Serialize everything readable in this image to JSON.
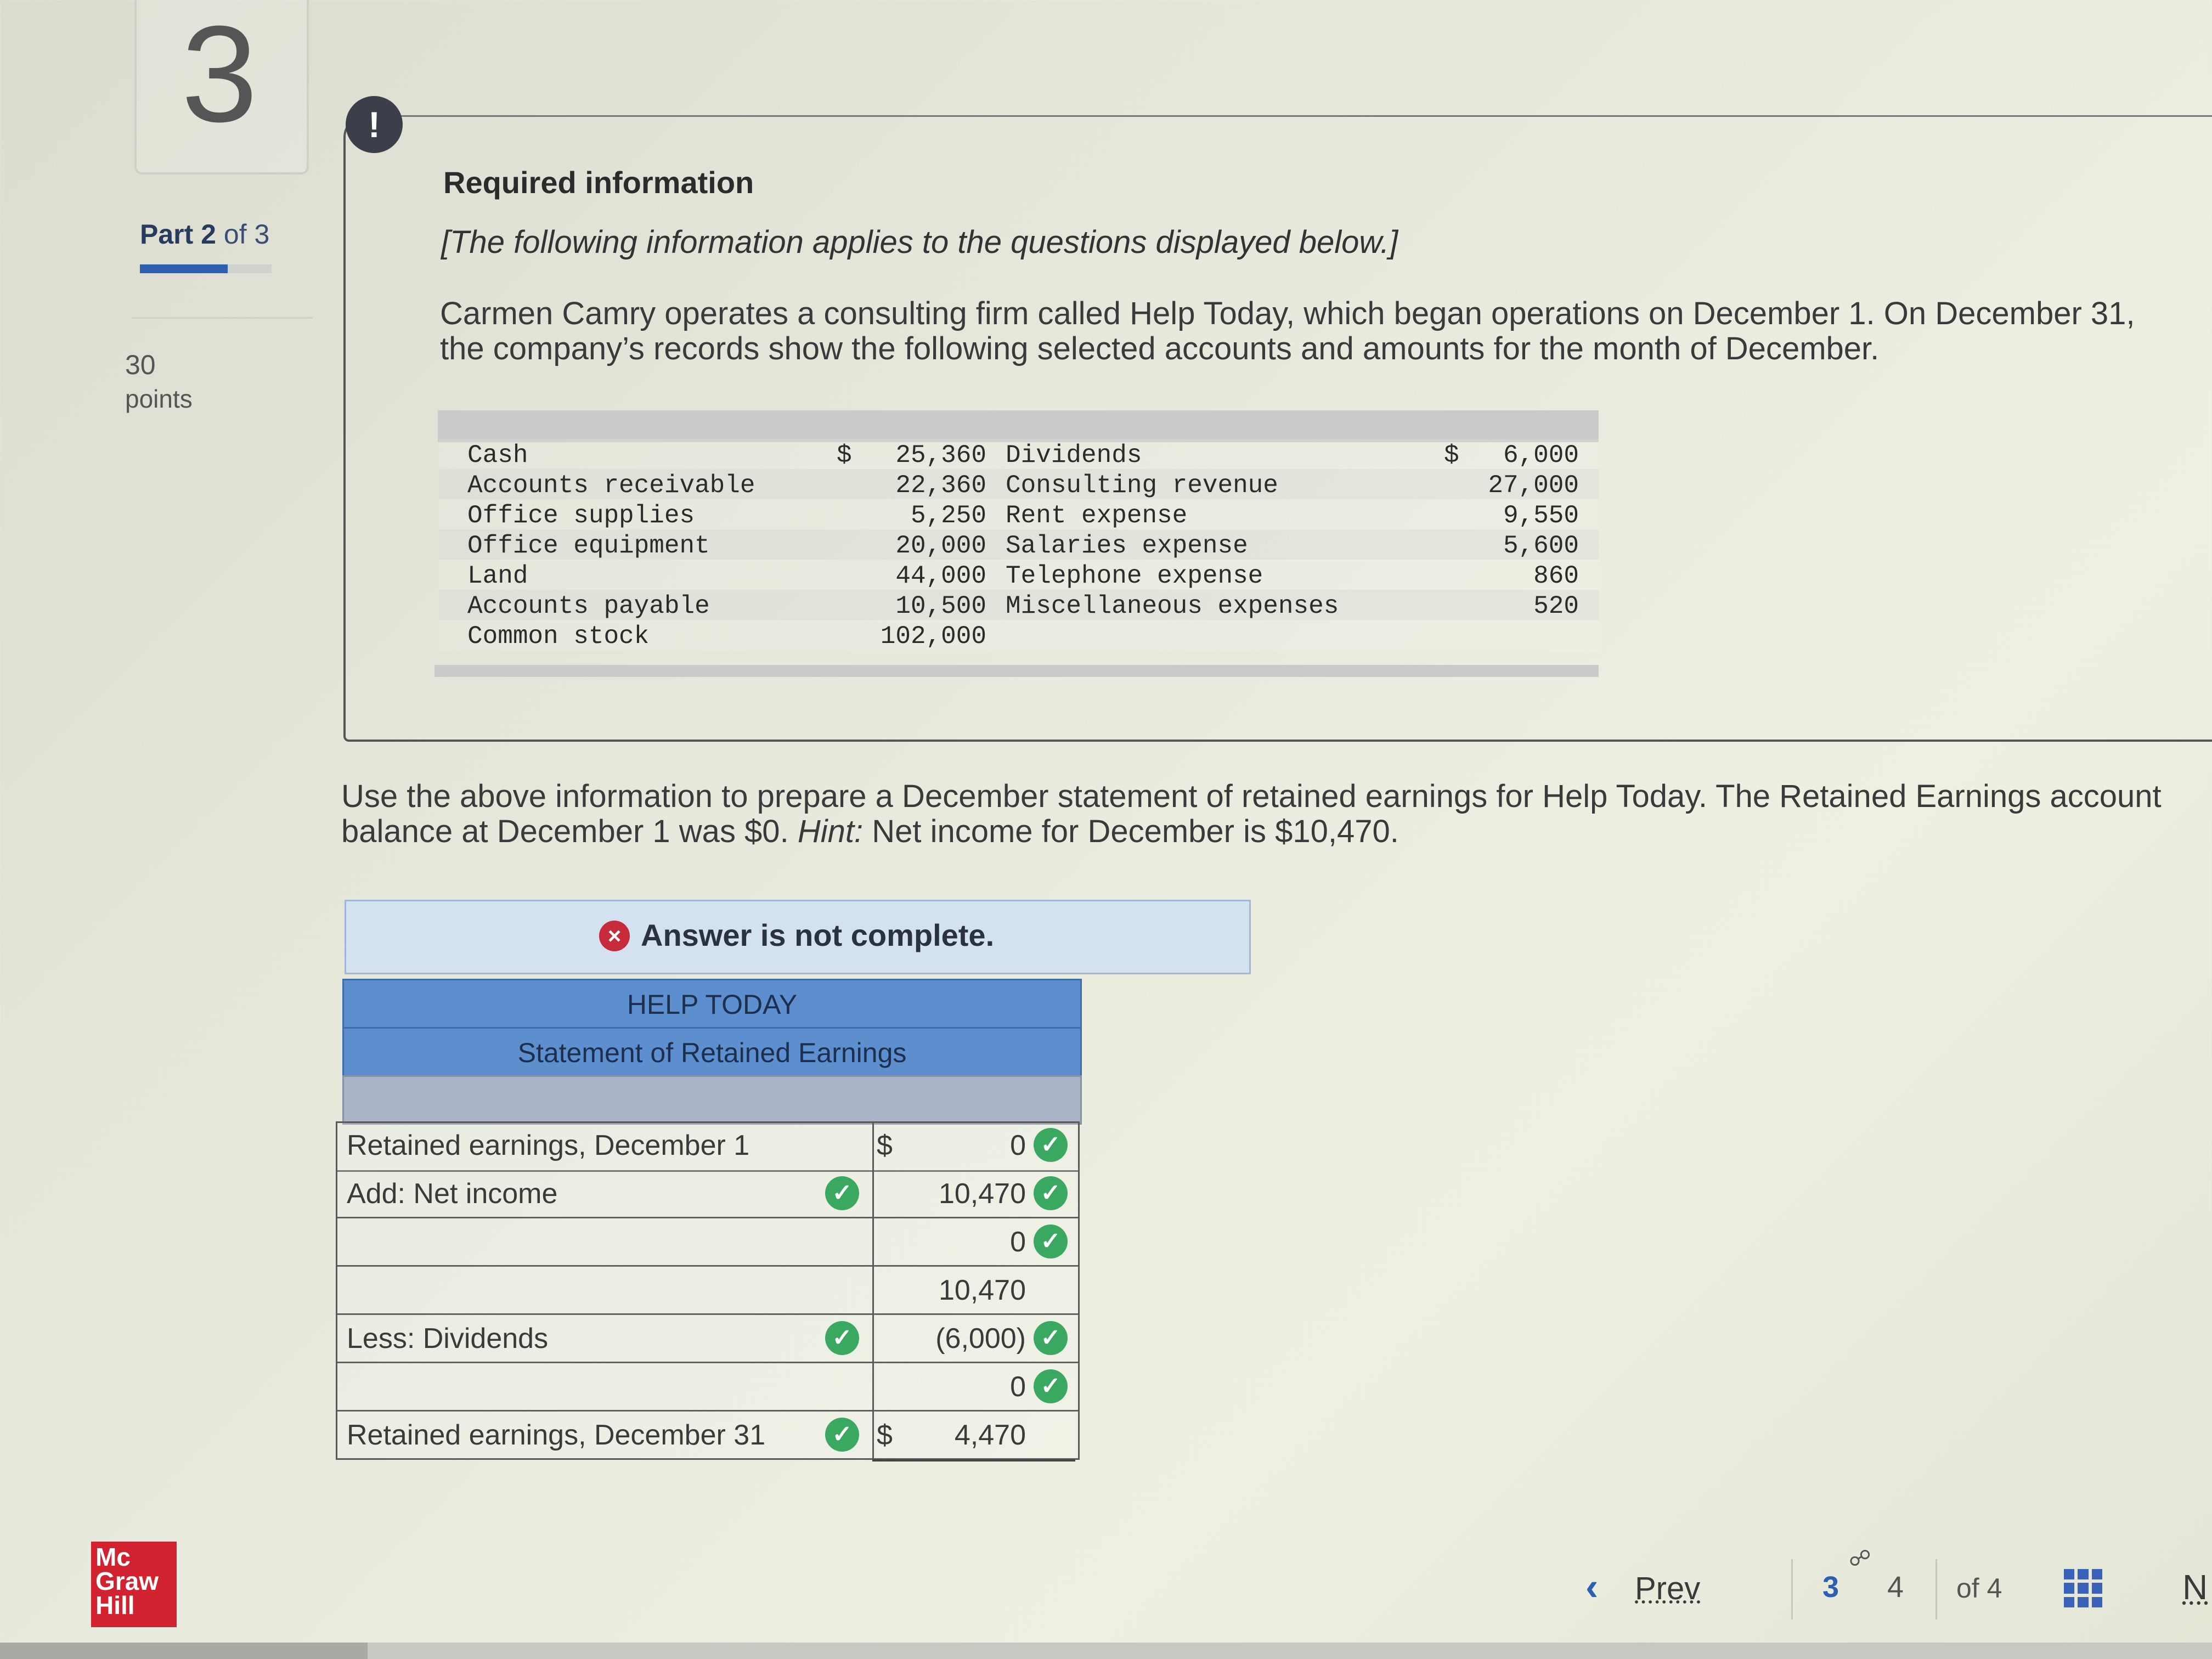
{
  "question": {
    "number": "3",
    "part_label": "Part",
    "part_current": "2",
    "part_of": "of 3",
    "points_value": "30",
    "points_label": "points"
  },
  "alert_icon": "!",
  "required_info": {
    "title": "Required information",
    "subtitle": "[The following information applies to the questions displayed below.]",
    "paragraph": "Carmen Camry operates a consulting firm called Help Today, which began operations on December 1. On December 31, the company’s records show the following selected accounts and amounts for the month of December."
  },
  "accounts_left": [
    {
      "name": "Cash",
      "dollar": "$",
      "amount": "25,360"
    },
    {
      "name": "Accounts receivable",
      "dollar": "",
      "amount": "22,360"
    },
    {
      "name": "Office supplies",
      "dollar": "",
      "amount": "5,250"
    },
    {
      "name": "Office equipment",
      "dollar": "",
      "amount": "20,000"
    },
    {
      "name": "Land",
      "dollar": "",
      "amount": "44,000"
    },
    {
      "name": "Accounts payable",
      "dollar": "",
      "amount": "10,500"
    },
    {
      "name": "Common stock",
      "dollar": "",
      "amount": "102,000"
    }
  ],
  "accounts_right": [
    {
      "name": "Dividends",
      "dollar": "$",
      "amount": "6,000"
    },
    {
      "name": "Consulting revenue",
      "dollar": "",
      "amount": "27,000"
    },
    {
      "name": "Rent expense",
      "dollar": "",
      "amount": "9,550"
    },
    {
      "name": "Salaries expense",
      "dollar": "",
      "amount": "5,600"
    },
    {
      "name": "Telephone expense",
      "dollar": "",
      "amount": "860"
    },
    {
      "name": "Miscellaneous expenses",
      "dollar": "",
      "amount": "520"
    }
  ],
  "instructions": {
    "text_before_hint": "Use the above information to prepare a December statement of retained earnings for Help Today. The Retained Earnings account balance at December 1 was $0.",
    "hint_label": "Hint:",
    "hint_text": "Net income for December is $10,470."
  },
  "answer_banner": {
    "icon": "×",
    "text": "Answer is not complete."
  },
  "statement": {
    "company": "HELP TODAY",
    "title": "Statement of Retained Earnings",
    "rows": [
      {
        "label": "Retained earnings, December 1",
        "dollar": "$",
        "amount": "0",
        "label_check": false,
        "amount_check": true
      },
      {
        "label": "Add: Net income",
        "dollar": "",
        "amount": "10,470",
        "label_check": true,
        "amount_check": true
      },
      {
        "label": "",
        "dollar": "",
        "amount": "0",
        "label_check": false,
        "amount_check": true
      },
      {
        "label": "",
        "dollar": "",
        "amount": "10,470",
        "label_check": false,
        "amount_check": false
      },
      {
        "label": "Less: Dividends",
        "dollar": "",
        "amount": "(6,000)",
        "label_check": true,
        "amount_check": true
      },
      {
        "label": "",
        "dollar": "",
        "amount": "0",
        "label_check": false,
        "amount_check": true
      },
      {
        "label": "Retained earnings, December 31",
        "dollar": "$",
        "amount": "4,470",
        "label_check": true,
        "amount_check": false
      }
    ],
    "check_icon": "✓"
  },
  "footer": {
    "logo_lines": [
      "Mc",
      "Graw",
      "Hill"
    ],
    "prev_label": "Prev",
    "prev_icon": "chevron-left-icon",
    "current_page": "3",
    "next_page": "4",
    "of_total": "of 4",
    "next_label": "N",
    "grid_icon": "grid-icon",
    "link_icon": "link-icon"
  },
  "colors": {
    "accent_blue": "#2d5fb0",
    "header_blue": "#5d8fcf",
    "check_green": "#3aa860",
    "error_red": "#c62b3b",
    "logo_red": "#d0232f"
  }
}
